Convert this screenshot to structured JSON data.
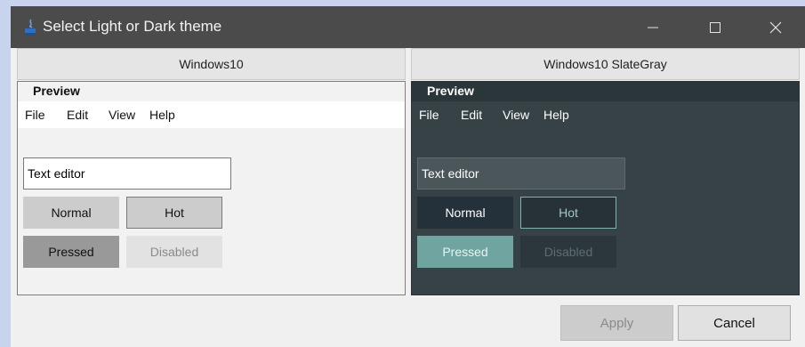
{
  "window": {
    "title": "Select Light or Dark theme",
    "controls": {
      "minimize": "—",
      "maximize": "☐",
      "close": "✕"
    }
  },
  "panels": [
    {
      "header": "Windows10",
      "preview_title": "Preview",
      "menu": [
        "File",
        "Edit",
        "View",
        "Help"
      ],
      "text_editor": "Text editor",
      "buttons": {
        "normal": "Normal",
        "hot": "Hot",
        "pressed": "Pressed",
        "disabled": "Disabled"
      }
    },
    {
      "header": "Windows10 SlateGray",
      "preview_title": "Preview",
      "menu": [
        "File",
        "Edit",
        "View",
        "Help"
      ],
      "text_editor": "Text editor",
      "buttons": {
        "normal": "Normal",
        "hot": "Hot",
        "pressed": "Pressed",
        "disabled": "Disabled"
      }
    }
  ],
  "footer": {
    "apply": "Apply",
    "cancel": "Cancel"
  },
  "colors": {
    "titlebar": "#4b4b4b",
    "dark_preview_bg": "#364246",
    "dark_pressed": "#6fa4a0",
    "dark_hot_border": "#7fb4ae"
  }
}
